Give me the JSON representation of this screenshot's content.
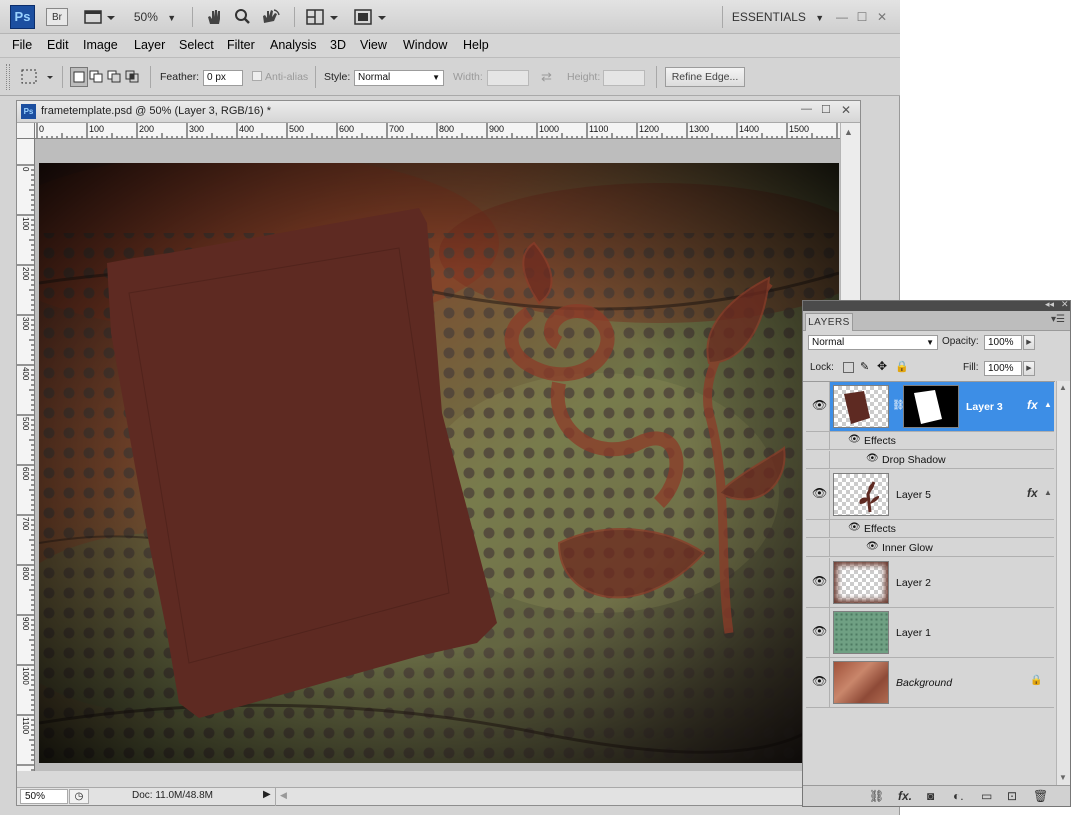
{
  "app": {
    "logo": "Ps",
    "bridge_label": "Br",
    "zoom_value": "50%",
    "workspace": "ESSENTIALS"
  },
  "menu": [
    "File",
    "Edit",
    "Image",
    "Layer",
    "Select",
    "Filter",
    "Analysis",
    "3D",
    "View",
    "Window",
    "Help"
  ],
  "options": {
    "feather_label": "Feather:",
    "feather_value": "0 px",
    "antialias_label": "Anti-alias",
    "style_label": "Style:",
    "style_value": "Normal",
    "width_label": "Width:",
    "height_label": "Height:",
    "refine_edge_label": "Refine Edge..."
  },
  "document": {
    "title": "frametemplate.psd @ 50% (Layer 3, RGB/16) *",
    "ruler_h": [
      "0",
      "100",
      "200",
      "300",
      "400",
      "500",
      "600",
      "700",
      "800",
      "900",
      "1000",
      "1100",
      "1200",
      "1300",
      "1400",
      "1500"
    ],
    "ruler_v": [
      "0",
      "100",
      "200",
      "300",
      "400",
      "500",
      "600",
      "700",
      "800",
      "900",
      "1000",
      "1100"
    ],
    "zoom_status": "50%",
    "doc_size": "Doc: 11.0M/48.8M"
  },
  "layers_panel": {
    "tab": "LAYERS",
    "blend_mode": "Normal",
    "opacity_label": "Opacity:",
    "opacity_value": "100%",
    "lock_label": "Lock:",
    "fill_label": "Fill:",
    "fill_value": "100%",
    "layers": [
      {
        "name": "Layer 3",
        "selected": true,
        "fx": "fx"
      },
      {
        "name": "Layer 5",
        "selected": false,
        "fx": "fx"
      },
      {
        "name": "Layer 2",
        "selected": false
      },
      {
        "name": "Layer 1",
        "selected": false
      },
      {
        "name": "Background",
        "selected": false
      }
    ],
    "effects_label": "Effects",
    "effect_drop_shadow": "Drop Shadow",
    "effect_inner_glow": "Inner Glow"
  },
  "colors": {
    "selection_blue": "#3d8ee6",
    "frame_brown": "#5e2a22"
  }
}
